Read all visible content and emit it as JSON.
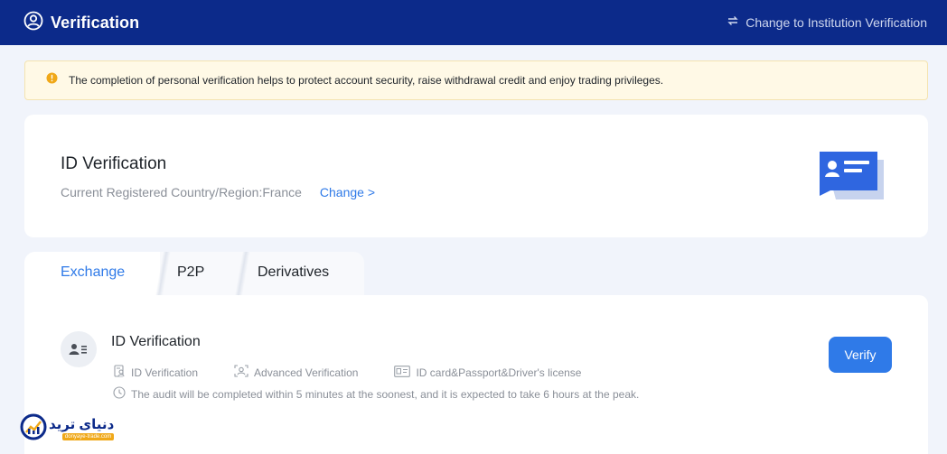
{
  "header": {
    "title": "Verification",
    "user_icon": "user-circle-icon",
    "switch_icon": "swap-icon",
    "switch_link": "Change to Institution Verification"
  },
  "notice": {
    "icon": "warning-icon",
    "text": "The completion of personal verification helps to protect account security, raise withdrawal credit and enjoy trading privileges."
  },
  "id_card": {
    "title": "ID Verification",
    "country_text": "Current Registered Country/Region:France",
    "change_label": "Change >",
    "illustration": "id-card-illustration"
  },
  "tabs": [
    {
      "label": "Exchange",
      "active": true
    },
    {
      "label": "P2P",
      "active": false
    },
    {
      "label": "Derivatives",
      "active": false
    }
  ],
  "verification": {
    "title": "ID Verification",
    "features": [
      {
        "icon": "document-user-icon",
        "label": "ID Verification"
      },
      {
        "icon": "face-scan-icon",
        "label": "Advanced Verification"
      },
      {
        "icon": "id-card-icon",
        "label": "ID card&Passport&Driver's license"
      }
    ],
    "note_icon": "clock-icon",
    "note": "The audit will be completed within 5 minutes at the soonest, and it is expected to take 6 hours at the peak.",
    "verify_label": "Verify"
  },
  "watermark": {
    "main": "دنیای ترید",
    "sub": "donyaye-trade.com"
  },
  "colors": {
    "header_bg": "#0c2a8a",
    "accent": "#2f7ae8",
    "notice_bg": "#fff9e6",
    "warning": "#f0a818",
    "page_bg": "#f1f4fb"
  }
}
